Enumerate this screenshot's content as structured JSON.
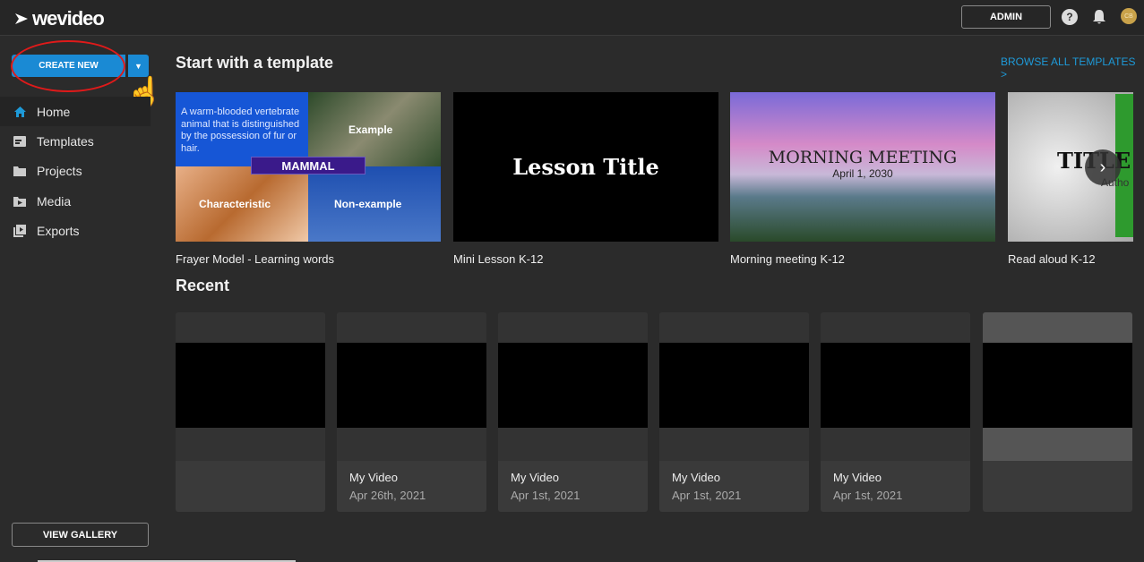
{
  "header": {
    "logo": "wevideo",
    "admin_label": "ADMIN",
    "help_icon": "question-circle-icon",
    "avatar_initials": "CB"
  },
  "sidebar": {
    "create_new": "CREATE NEW",
    "items": [
      {
        "label": "Home",
        "icon": "home-icon"
      },
      {
        "label": "Templates",
        "icon": "templates-icon"
      },
      {
        "label": "Projects",
        "icon": "folder-icon"
      },
      {
        "label": "Media",
        "icon": "media-folder-icon"
      },
      {
        "label": "Exports",
        "icon": "exports-icon"
      }
    ],
    "view_gallery": "VIEW GALLERY"
  },
  "main": {
    "templates_title": "Start with a template",
    "browse_all": "BROWSE ALL TEMPLATES >",
    "templates": [
      {
        "label": "Frayer Model - Learning words",
        "thumb": {
          "definition": "A warm-blooded vertebrate animal that is distinguished by the possession of fur or hair.",
          "word": "MAMMAL",
          "example": "Example",
          "characteristic": "Characteristic",
          "non_example": "Non-example"
        }
      },
      {
        "label": "Mini Lesson K-12",
        "thumb": {
          "title": "Lesson Title"
        }
      },
      {
        "label": "Morning meeting K-12",
        "thumb": {
          "title": "MORNING MEETING",
          "date": "April 1, 2030"
        }
      },
      {
        "label": "Read aloud K-12",
        "thumb": {
          "title": "TITLE O",
          "author": "Autho"
        }
      }
    ],
    "recent_title": "Recent",
    "recent": [
      {
        "title": "",
        "date": ""
      },
      {
        "title": "My Video",
        "date": "Apr 26th, 2021"
      },
      {
        "title": "My Video",
        "date": "Apr 1st, 2021"
      },
      {
        "title": "My Video",
        "date": "Apr 1st, 2021"
      },
      {
        "title": "My Video",
        "date": "Apr 1st, 2021"
      },
      {
        "title": "",
        "date": ""
      }
    ]
  },
  "colors": {
    "accent": "#1a8ad4",
    "link": "#1e9ad8",
    "annotation": "#e01a1a"
  }
}
